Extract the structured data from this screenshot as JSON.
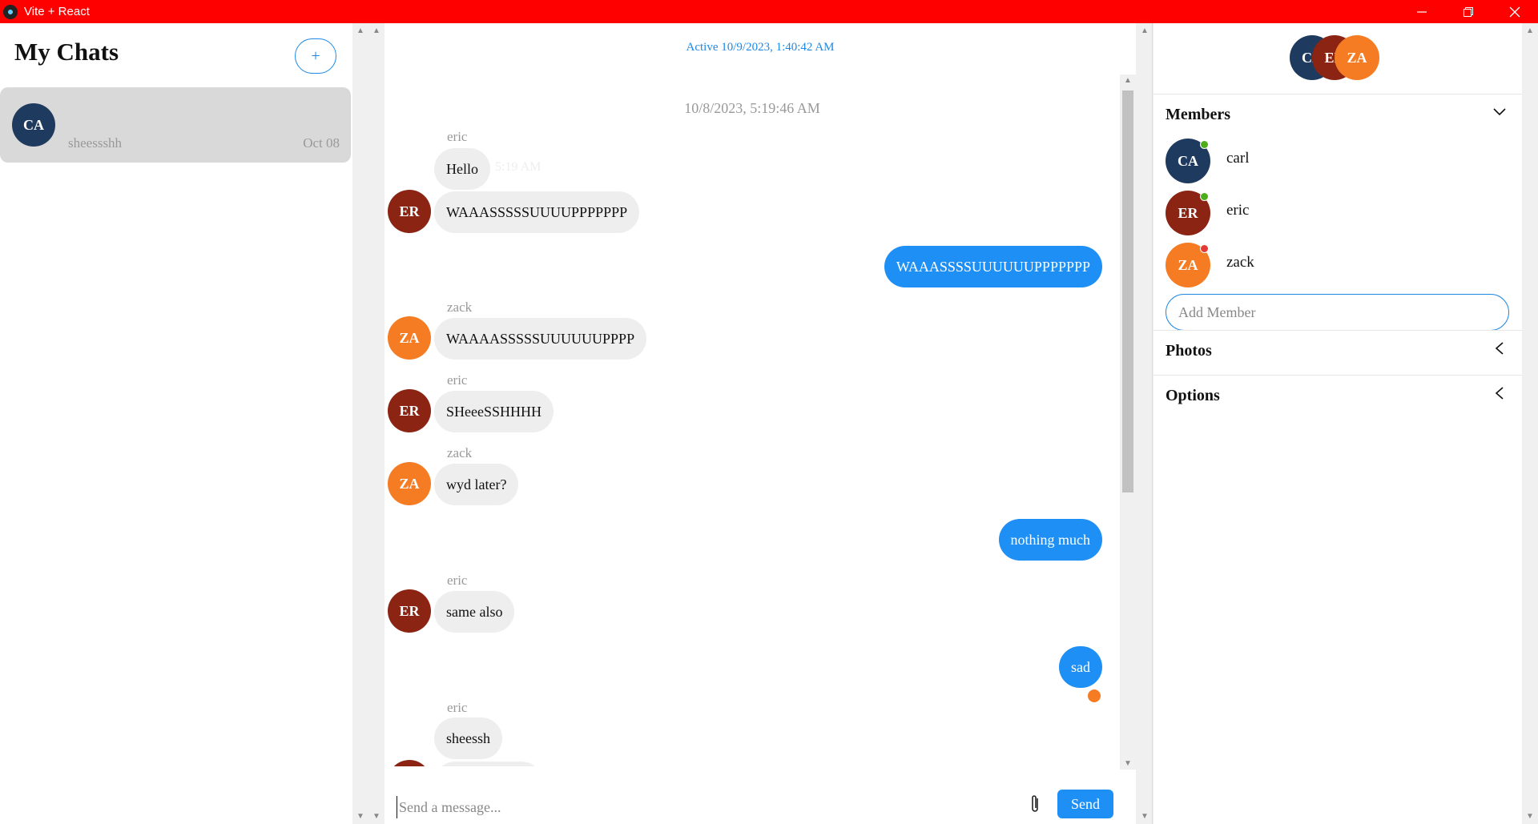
{
  "window": {
    "title": "Vite + React",
    "controls": [
      "—",
      "❐",
      "✕"
    ]
  },
  "left": {
    "title": "My Chats",
    "new_chat_label": "+",
    "chats": [
      {
        "initials": "CA",
        "preview": "sheessshh",
        "date": "Oct 08",
        "color": "#1f3a5f"
      }
    ]
  },
  "center": {
    "active_status": "Active 10/9/2023, 1:40:42 AM",
    "date_header": "10/8/2023, 5:19:46 AM",
    "messages": [
      {
        "sender": "eric",
        "text": "Hello",
        "time": "5:19 AM",
        "dir": "in"
      },
      {
        "sender": "eric",
        "initials": "ER",
        "text": "WAAASSSSSUUUUPPPPPPP",
        "dir": "in"
      },
      {
        "text": "WAAASSSSUUUUUUPPPPPPP",
        "dir": "out"
      },
      {
        "sender": "zack",
        "initials": "ZA",
        "text": "WAAAASSSSSUUUUUUPPPP",
        "dir": "in"
      },
      {
        "sender": "eric",
        "initials": "ER",
        "text": "SHeeeSSHHHH",
        "dir": "in"
      },
      {
        "sender": "zack",
        "initials": "ZA",
        "text": "wyd later?",
        "dir": "in"
      },
      {
        "text": "nothing much",
        "dir": "out"
      },
      {
        "sender": "eric",
        "initials": "ER",
        "text": "same also",
        "dir": "in"
      },
      {
        "text": "sad",
        "dir": "out"
      },
      {
        "sender": "eric",
        "text": "sheessh",
        "dir": "in"
      }
    ],
    "composer": {
      "placeholder": "Send a message...",
      "send_label": "Send",
      "attach_icon": "paperclip-icon"
    }
  },
  "right": {
    "group_initials": [
      "CA",
      "ER",
      "ZA"
    ],
    "sections": {
      "members": "Members",
      "photos": "Photos",
      "options": "Options"
    },
    "members": [
      {
        "initials": "CA",
        "name": "carl",
        "color": "#1f3a5f",
        "status": "online",
        "status_color": "#4caf1a"
      },
      {
        "initials": "ER",
        "name": "eric",
        "color": "#8b2413",
        "status": "online",
        "status_color": "#4caf1a"
      },
      {
        "initials": "ZA",
        "name": "zack",
        "color": "#f57c22",
        "status": "offline",
        "status_color": "#e53935"
      }
    ],
    "add_member_placeholder": "Add Member"
  },
  "colors": {
    "titlebar": "#ff0000",
    "accent": "#1e90f5",
    "carl": "#1f3a5f",
    "eric": "#8b2413",
    "zack": "#f57c22"
  }
}
